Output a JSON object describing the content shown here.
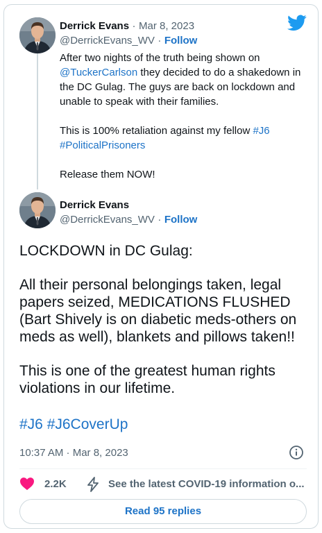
{
  "colors": {
    "accent": "#1d73c7",
    "like": "#f91880",
    "muted": "#536471",
    "border": "#cfd9de"
  },
  "icons": {
    "logo": "twitter-bird-icon",
    "info": "info-icon",
    "like": "heart-icon",
    "covid": "lightning-bolt-icon"
  },
  "quoted_tweet": {
    "name": "Derrick Evans",
    "separator": "·",
    "date": "Mar 8, 2023",
    "handle": "@DerrickEvans_WV",
    "follow": "Follow",
    "text_1a": "After two nights of the truth being shown on",
    "mention": "@TuckerCarlson",
    "text_1b": " they decided to do a shakedown in the DC Gulag. The guys are back on lockdown and unable to speak with their families.",
    "text_2a": "This is 100% retaliation against my fellow ",
    "hashtag_1": "#J6",
    "hashtag_2": "#PoliticalPrisoners",
    "text_3": "Release them NOW!"
  },
  "main_tweet": {
    "name": "Derrick Evans",
    "handle": "@DerrickEvans_WV",
    "separator": "·",
    "follow": "Follow",
    "paragraph_1": "LOCKDOWN in DC Gulag:",
    "paragraph_2": "All their personal belongings taken, legal papers seized, MEDICATIONS FLUSHED (Bart Shively is on diabetic meds-others on meds as well), blankets and pillows taken!!",
    "paragraph_3": "This is one of the greatest human rights violations in our lifetime.",
    "hashtag_1": "#J6",
    "hashtag_2": "#J6CoverUp",
    "timestamp": "10:37 AM · Mar 8, 2023"
  },
  "actions": {
    "likes": "2.2K",
    "covid_label": "See the latest COVID-19 information o..."
  },
  "replies_button": "Read 95 replies"
}
